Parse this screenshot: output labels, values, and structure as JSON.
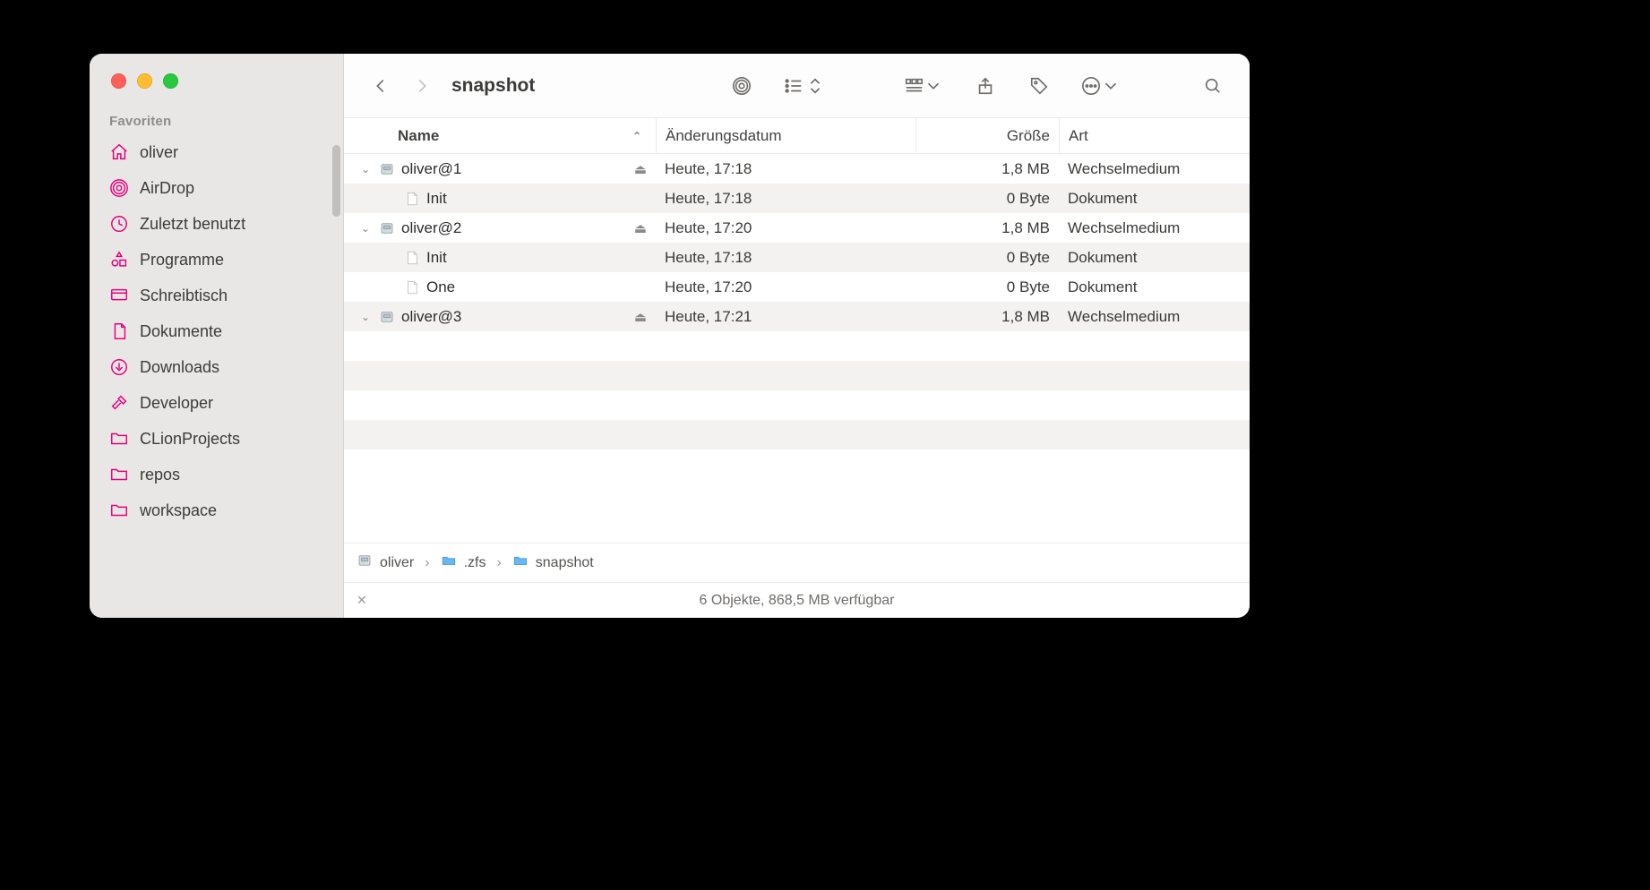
{
  "window_title": "snapshot",
  "sidebar": {
    "heading": "Favoriten",
    "items": [
      {
        "label": "oliver",
        "icon": "home"
      },
      {
        "label": "AirDrop",
        "icon": "airdrop"
      },
      {
        "label": "Zuletzt benutzt",
        "icon": "clock"
      },
      {
        "label": "Programme",
        "icon": "apps"
      },
      {
        "label": "Schreibtisch",
        "icon": "desktop"
      },
      {
        "label": "Dokumente",
        "icon": "doc"
      },
      {
        "label": "Downloads",
        "icon": "download"
      },
      {
        "label": "Developer",
        "icon": "hammer"
      },
      {
        "label": "CLionProjects",
        "icon": "folder"
      },
      {
        "label": "repos",
        "icon": "folder"
      },
      {
        "label": "workspace",
        "icon": "folder"
      }
    ]
  },
  "columns": {
    "name": "Name",
    "date": "Änderungsdatum",
    "size": "Größe",
    "kind": "Art"
  },
  "rows": [
    {
      "depth": 0,
      "disclosure": "open",
      "icon": "disk",
      "name": "oliver@1",
      "eject": true,
      "date": "Heute, 17:18",
      "size": "1,8 MB",
      "kind": "Wechselmedium"
    },
    {
      "depth": 1,
      "disclosure": "",
      "icon": "file",
      "name": "Init",
      "eject": false,
      "date": "Heute, 17:18",
      "size": "0 Byte",
      "kind": "Dokument"
    },
    {
      "depth": 0,
      "disclosure": "open",
      "icon": "disk",
      "name": "oliver@2",
      "eject": true,
      "date": "Heute, 17:20",
      "size": "1,8 MB",
      "kind": "Wechselmedium"
    },
    {
      "depth": 1,
      "disclosure": "",
      "icon": "file",
      "name": "Init",
      "eject": false,
      "date": "Heute, 17:18",
      "size": "0 Byte",
      "kind": "Dokument"
    },
    {
      "depth": 1,
      "disclosure": "",
      "icon": "file",
      "name": "One",
      "eject": false,
      "date": "Heute, 17:20",
      "size": "0 Byte",
      "kind": "Dokument"
    },
    {
      "depth": 0,
      "disclosure": "open",
      "icon": "disk",
      "name": "oliver@3",
      "eject": true,
      "date": "Heute, 17:21",
      "size": "1,8 MB",
      "kind": "Wechselmedium"
    }
  ],
  "empty_rows": 5,
  "path": [
    {
      "icon": "disk",
      "label": "oliver"
    },
    {
      "icon": "folder",
      "label": ".zfs"
    },
    {
      "icon": "folder",
      "label": "snapshot"
    }
  ],
  "status": "6 Objekte, 868,5 MB verfügbar"
}
